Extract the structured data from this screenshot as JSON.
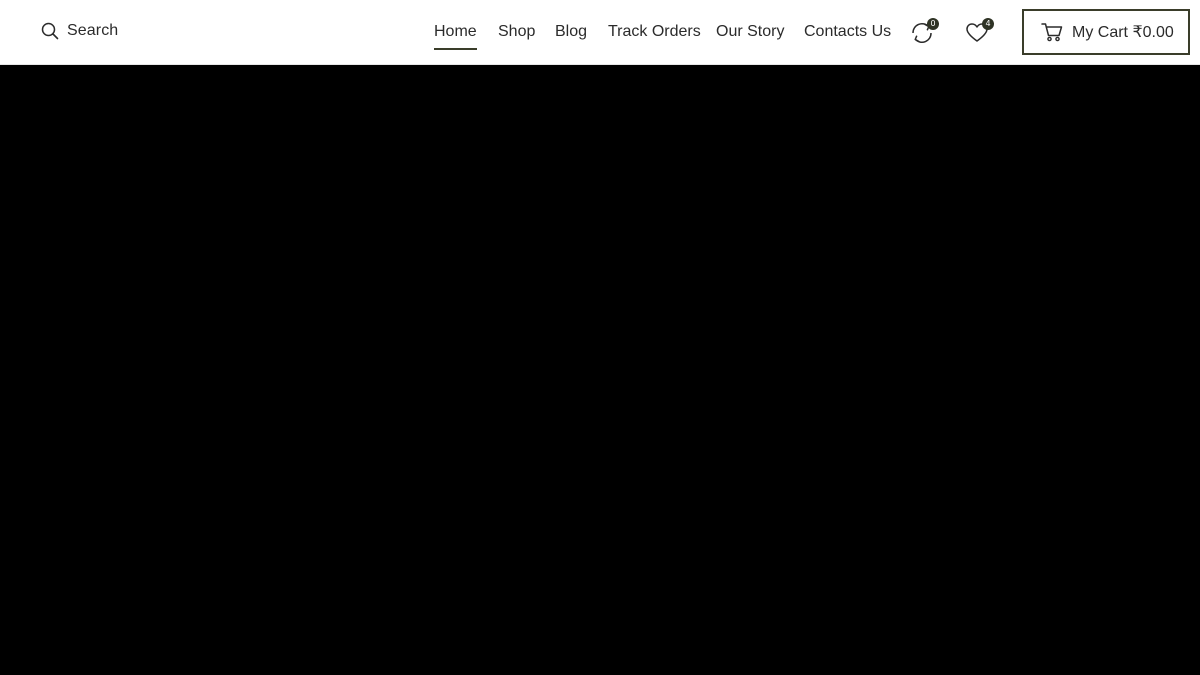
{
  "header": {
    "search_label": "Search",
    "nav": [
      {
        "label": "Home",
        "active": true
      },
      {
        "label": "Shop",
        "active": false
      },
      {
        "label": "Blog",
        "active": false
      },
      {
        "label": "Track Orders",
        "active": false
      },
      {
        "label": "Our Story",
        "active": false
      },
      {
        "label": "Contacts Us",
        "active": false
      }
    ],
    "compare_count": "0",
    "wishlist_count": "4",
    "cart_label": "My Cart ₹0.00"
  },
  "icons": {
    "search": "search-icon",
    "compare": "compare-icon",
    "wishlist": "heart-icon",
    "cart": "cart-icon"
  },
  "colors": {
    "accent": "#3a3d2a",
    "badge": "#2f3325",
    "hero_background": "#000000"
  }
}
